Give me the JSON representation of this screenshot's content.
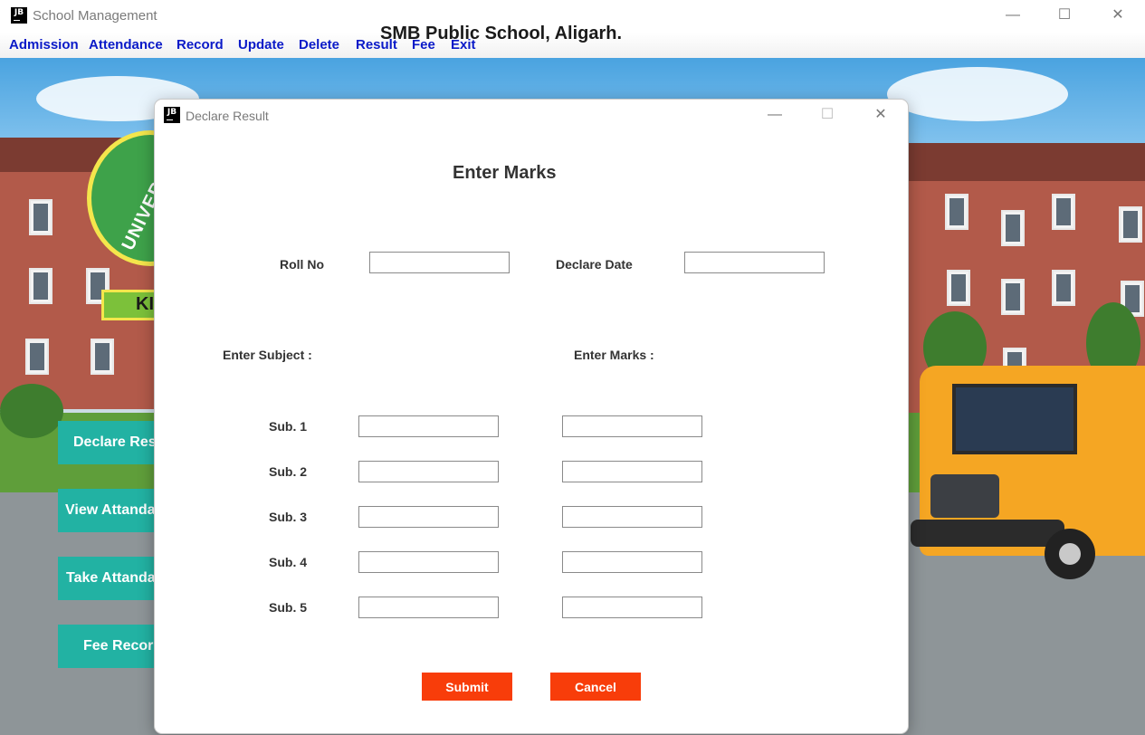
{
  "main_window": {
    "title": "School Management",
    "app_icon": "JB",
    "controls": {
      "minimize": "—",
      "maximize": "☐",
      "close": "✕"
    },
    "menu": [
      "Admission",
      "Attendance",
      "Record",
      "Update",
      "Delete",
      "Result",
      "Fee",
      "Exit"
    ],
    "school_name": "SMB Public School,  Aligarh.",
    "logo_text": "UNIVERSAL",
    "logo_banner": "KI",
    "side_buttons": [
      "Declare Result",
      "View Attandance",
      "Take Attandance",
      "Fee Record"
    ]
  },
  "dialog": {
    "title": "Declare Result",
    "app_icon": "JB",
    "controls": {
      "minimize": "—",
      "maximize": "☐",
      "close": "✕"
    },
    "heading": "Enter Marks",
    "roll_no_label": "Roll No",
    "roll_no_value": "",
    "declare_date_label": "Declare  Date",
    "declare_date_value": "",
    "subject_header": "Enter Subject :",
    "marks_header": "Enter Marks :",
    "rows": [
      {
        "label": "Sub. 1",
        "subject": "",
        "marks": ""
      },
      {
        "label": "Sub. 2",
        "subject": "",
        "marks": ""
      },
      {
        "label": "Sub. 3",
        "subject": "",
        "marks": ""
      },
      {
        "label": "Sub. 4",
        "subject": "",
        "marks": ""
      },
      {
        "label": "Sub. 5",
        "subject": "",
        "marks": ""
      }
    ],
    "submit_label": "Submit",
    "cancel_label": "Cancel"
  },
  "colors": {
    "menu_text": "#0a1ac8",
    "side_button": "#22b2a3",
    "action_button": "#f83d0a"
  }
}
